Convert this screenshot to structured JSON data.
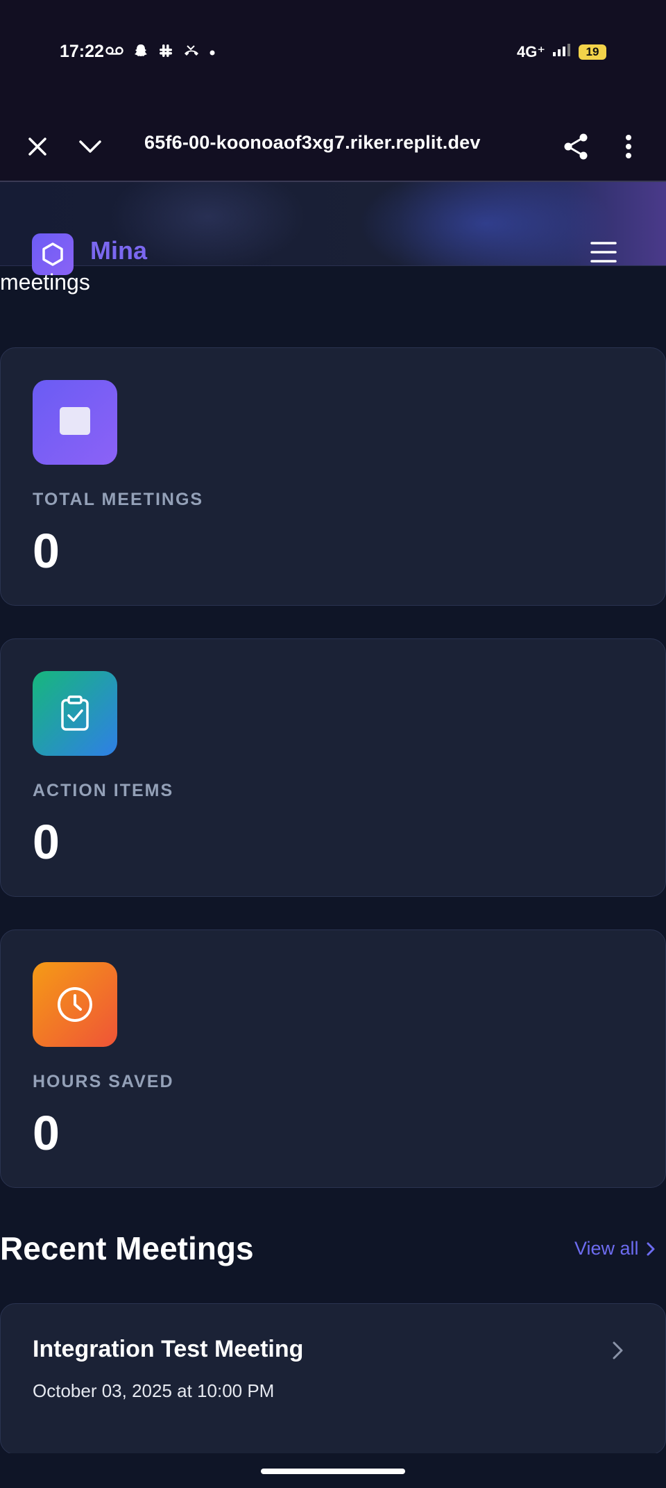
{
  "status_bar": {
    "time": "17:22",
    "network": "4G⁺",
    "battery": "19"
  },
  "browser": {
    "url": "65f6-00-koonoaof3xg7.riker.replit.dev"
  },
  "app": {
    "brand": "Mina",
    "partial_heading": "meetings"
  },
  "stats": [
    {
      "label": "TOTAL MEETINGS",
      "value": "0",
      "icon": "stop-square-icon"
    },
    {
      "label": "ACTION ITEMS",
      "value": "0",
      "icon": "clipboard-check-icon"
    },
    {
      "label": "HOURS SAVED",
      "value": "0",
      "icon": "clock-icon"
    }
  ],
  "recent": {
    "title": "Recent Meetings",
    "view_all": "View all",
    "meetings": [
      {
        "title": "Integration Test Meeting",
        "date": "October 03, 2025 at 10:00 PM"
      }
    ]
  },
  "colors": {
    "background": "#0f1527",
    "card": "#1b2236",
    "accent": "#6d6cf0"
  }
}
